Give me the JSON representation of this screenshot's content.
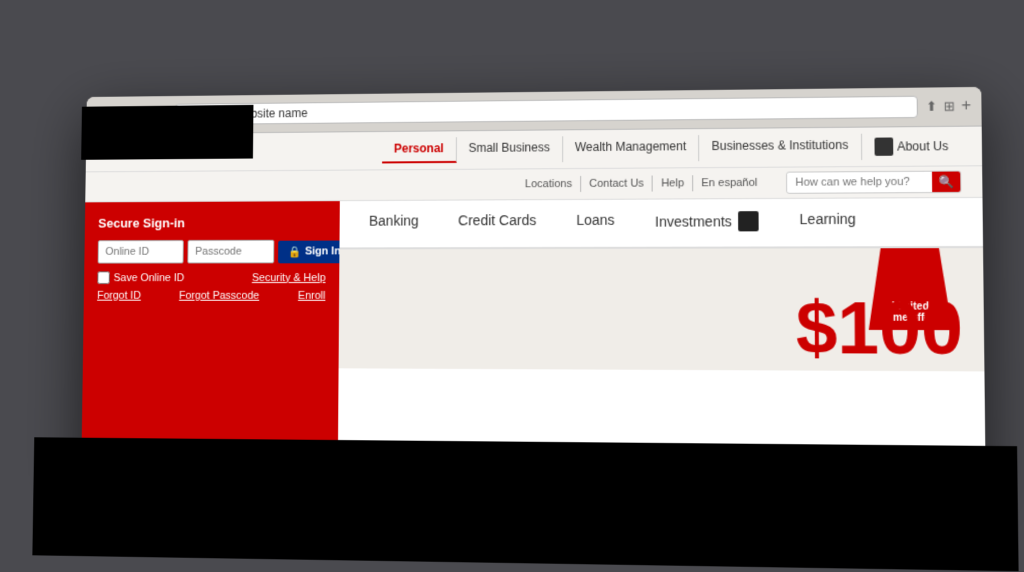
{
  "browser": {
    "address_bar_text": "h or enter website name",
    "add_tab_label": "+"
  },
  "topnav": {
    "links": [
      {
        "label": "Personal",
        "active": true
      },
      {
        "label": "Small Business",
        "active": false
      },
      {
        "label": "Wealth Management",
        "active": false
      },
      {
        "label": "Businesses & Institutions",
        "active": false
      },
      {
        "label": "About Us",
        "active": false
      }
    ]
  },
  "secondarynav": {
    "links": [
      {
        "label": "Locations"
      },
      {
        "label": "Contact Us"
      },
      {
        "label": "Help"
      },
      {
        "label": "En español"
      }
    ],
    "search_placeholder": "How can we help you?"
  },
  "signin": {
    "title": "Secure Sign-in",
    "online_id_placeholder": "Online ID",
    "passcode_placeholder": "Passcode",
    "sign_in_label": "Sign In",
    "save_id_label": "Save Online ID",
    "security_help_label": "Security & Help",
    "forgot_id_label": "Forgot ID",
    "forgot_passcode_label": "Forgot Passcode",
    "enroll_label": "Enroll"
  },
  "mainnav": {
    "tabs": [
      {
        "label": "Banking"
      },
      {
        "label": "Credit Cards"
      },
      {
        "label": "Loans"
      },
      {
        "label": "Investments"
      },
      {
        "label": "Learning"
      }
    ]
  },
  "hero": {
    "badge_line1": "Limited",
    "badge_line2": "time offer",
    "amount": "$100"
  }
}
